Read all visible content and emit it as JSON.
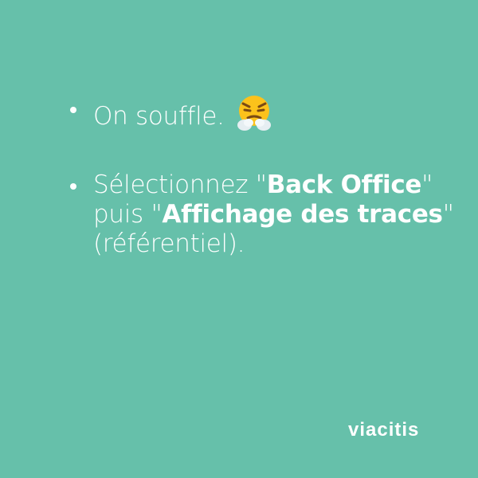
{
  "bullets": [
    {
      "text": "On souffle.",
      "emoji": "face-with-steam-from-nose-icon"
    },
    {
      "line1_prefix": "Sélectionnez \"",
      "line1_bold": "Back Office",
      "line1_suffix": "\"",
      "line2_prefix": "puis \"",
      "line2_bold": "Affichage des traces",
      "line2_suffix": "\"",
      "line3": "(référentiel)."
    }
  ],
  "brand": {
    "logo_text": "viacitis"
  },
  "colors": {
    "background": "#66c0aa",
    "text": "#ffffff",
    "emoji_face": "#fcc21b",
    "emoji_steam": "#e6eef2"
  }
}
